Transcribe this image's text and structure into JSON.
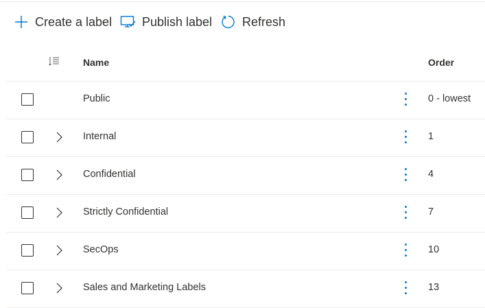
{
  "toolbar": {
    "create_label": "Create a label",
    "publish_label": "Publish label",
    "refresh_label": "Refresh"
  },
  "table": {
    "headers": {
      "name": "Name",
      "order": "Order"
    },
    "rows": [
      {
        "name": "Public",
        "order": "0 - lowest",
        "expandable": false
      },
      {
        "name": "Internal",
        "order": "1",
        "expandable": true
      },
      {
        "name": "Confidential",
        "order": "4",
        "expandable": true
      },
      {
        "name": "Strictly Confidential",
        "order": "7",
        "expandable": true
      },
      {
        "name": "SecOps",
        "order": "10",
        "expandable": true
      },
      {
        "name": "Sales and Marketing Labels",
        "order": "13",
        "expandable": true
      }
    ]
  },
  "colors": {
    "accent": "#0078d4",
    "text": "#323130",
    "divider": "#edebe9"
  },
  "icons": [
    "add-icon",
    "publish-icon",
    "refresh-icon",
    "column-options-icon",
    "chevron-right-icon",
    "more-vertical-icon"
  ]
}
